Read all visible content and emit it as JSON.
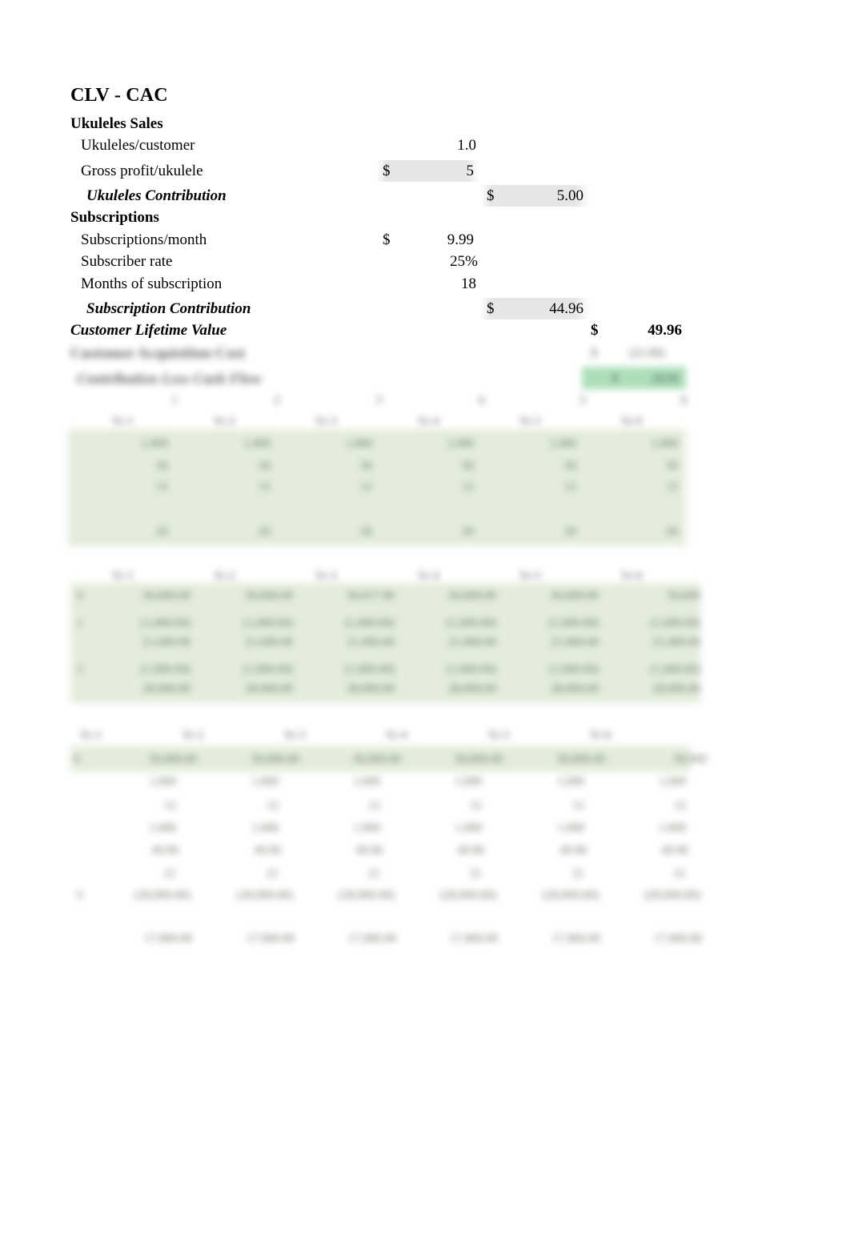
{
  "document": {
    "title": "CLV - CAC"
  },
  "sections": {
    "ukuleles_sales": {
      "heading": "Ukuleles Sales",
      "rows": [
        {
          "label": "Ukuleles/customer",
          "currency": "",
          "value": "1.0"
        },
        {
          "label": "Gross profit/ukulele",
          "currency": "$",
          "value": "5"
        }
      ],
      "subtotal": {
        "label": "Ukuleles Contribution",
        "currency": "$",
        "value": "5.00"
      }
    },
    "subscriptions": {
      "heading": "Subscriptions",
      "rows": [
        {
          "label": "Subscriptions/month",
          "currency": "$",
          "value": "9.99"
        },
        {
          "label": "Subscriber rate",
          "currency": "",
          "value": "25%"
        },
        {
          "label": "Months of subscription",
          "currency": "",
          "value": "18"
        }
      ],
      "subtotal": {
        "label": "Subscription Contribution",
        "currency": "$",
        "value": "44.96"
      }
    },
    "grand_total": {
      "label": "Customer Lifetime Value",
      "currency": "$",
      "value": "49.96"
    }
  },
  "redacted": {
    "note": "blurred",
    "labels": [
      "Customer Acquisition Cost",
      "Contribution Less Cash Flow"
    ],
    "colors": {
      "band_green": "#e2ecd9",
      "highlight_green": "#a6dcb4",
      "cell_shade": "#e2e2e2"
    },
    "tables": [
      {
        "name": "table-one",
        "columns": 6,
        "rows": 5
      },
      {
        "name": "table-two",
        "columns": 6,
        "rows": 5
      },
      {
        "name": "table-three",
        "columns": 6,
        "rows": 8
      }
    ]
  }
}
